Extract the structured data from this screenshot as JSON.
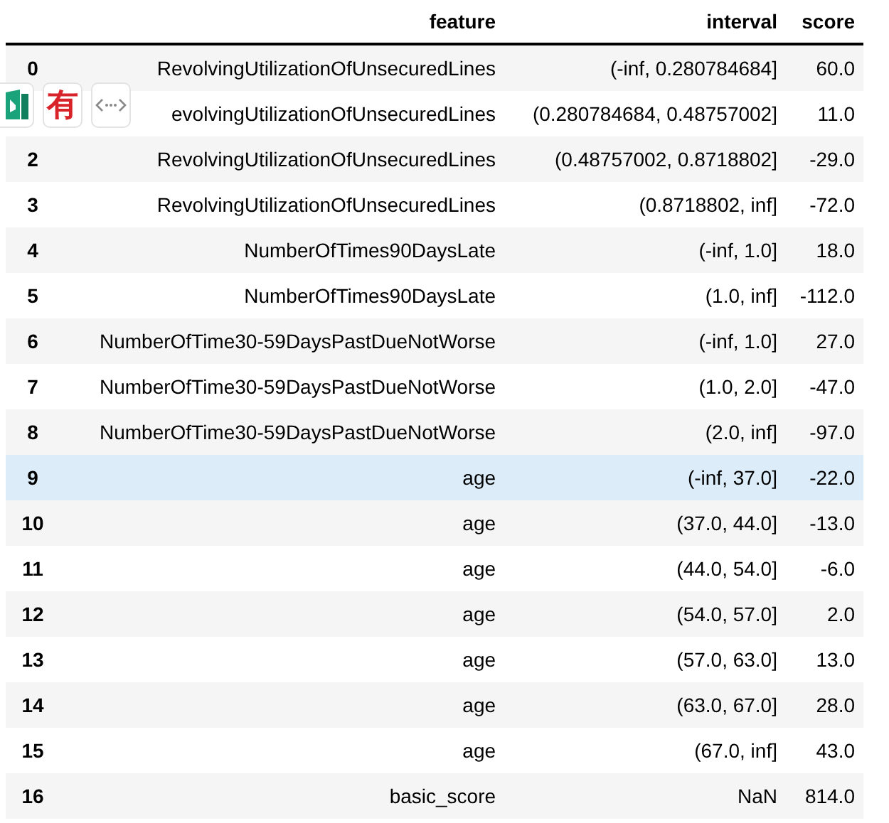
{
  "table": {
    "columns": [
      "feature",
      "interval",
      "score"
    ],
    "rows": [
      {
        "index": "0",
        "feature": "RevolvingUtilizationOfUnsecuredLines",
        "interval": "(-inf, 0.280784684]",
        "score": "60.0",
        "selected": false
      },
      {
        "feature": "evolvingUtilizationOfUnsecuredLines",
        "interval": "(0.280784684, 0.48757002]",
        "score": "11.0",
        "selected": false
      },
      {
        "index": "2",
        "feature": "RevolvingUtilizationOfUnsecuredLines",
        "interval": "(0.48757002, 0.8718802]",
        "score": "-29.0",
        "selected": false
      },
      {
        "index": "3",
        "feature": "RevolvingUtilizationOfUnsecuredLines",
        "interval": "(0.8718802, inf]",
        "score": "-72.0",
        "selected": false
      },
      {
        "index": "4",
        "feature": "NumberOfTimes90DaysLate",
        "interval": "(-inf, 1.0]",
        "score": "18.0",
        "selected": false
      },
      {
        "index": "5",
        "feature": "NumberOfTimes90DaysLate",
        "interval": "(1.0, inf]",
        "score": "-112.0",
        "selected": false
      },
      {
        "index": "6",
        "feature": "NumberOfTime30-59DaysPastDueNotWorse",
        "interval": "(-inf, 1.0]",
        "score": "27.0",
        "selected": false
      },
      {
        "index": "7",
        "feature": "NumberOfTime30-59DaysPastDueNotWorse",
        "interval": "(1.0, 2.0]",
        "score": "-47.0",
        "selected": false
      },
      {
        "index": "8",
        "feature": "NumberOfTime30-59DaysPastDueNotWorse",
        "interval": "(2.0, inf]",
        "score": "-97.0",
        "selected": false
      },
      {
        "index": "9",
        "feature": "age",
        "interval": "(-inf, 37.0]",
        "score": "-22.0",
        "selected": true
      },
      {
        "index": "10",
        "feature": "age",
        "interval": "(37.0, 44.0]",
        "score": "-13.0",
        "selected": false
      },
      {
        "index": "11",
        "feature": "age",
        "interval": "(44.0, 54.0]",
        "score": "-6.0",
        "selected": false
      },
      {
        "index": "12",
        "feature": "age",
        "interval": "(54.0, 57.0]",
        "score": "2.0",
        "selected": false
      },
      {
        "index": "13",
        "feature": "age",
        "interval": "(57.0, 63.0]",
        "score": "13.0",
        "selected": false
      },
      {
        "index": "14",
        "feature": "age",
        "interval": "(63.0, 67.0]",
        "score": "28.0",
        "selected": false
      },
      {
        "index": "15",
        "feature": "age",
        "interval": "(67.0, inf]",
        "score": "43.0",
        "selected": false
      },
      {
        "index": "16",
        "feature": "basic_score",
        "interval": "NaN",
        "score": "814.0",
        "selected": false
      }
    ]
  },
  "floating_toolbar": {
    "middle_button_glyph": "有"
  }
}
